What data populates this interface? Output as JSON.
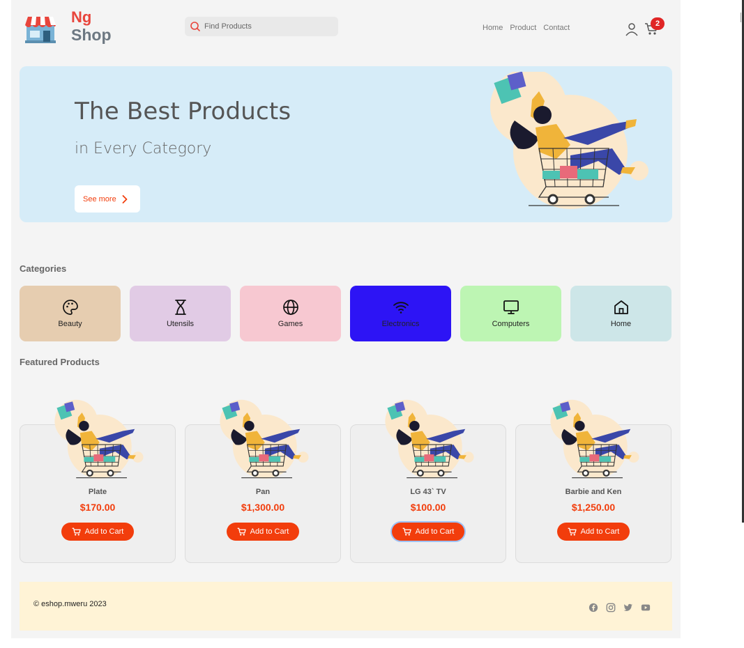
{
  "header": {
    "logo_line1": "Ng",
    "logo_line2": "Shop",
    "search_placeholder": "Find Products",
    "nav": [
      "Home",
      "Product",
      "Contact"
    ],
    "cart_count": "2"
  },
  "hero": {
    "title": "The Best Products",
    "subtitle": "in Every Category",
    "button_label": "See more"
  },
  "categories": {
    "title": "Categories",
    "items": [
      {
        "label": "Beauty",
        "icon": "palette-icon",
        "color": "#e6cdb0"
      },
      {
        "label": "Utensils",
        "icon": "hourglass-icon",
        "color": "#e1cbe5"
      },
      {
        "label": "Games",
        "icon": "globe-icon",
        "color": "#f7c8d1"
      },
      {
        "label": "Electronics",
        "icon": "wifi-icon",
        "color": "#2d14f5"
      },
      {
        "label": "Computers",
        "icon": "monitor-icon",
        "color": "#bdf5b3"
      },
      {
        "label": "Home",
        "icon": "home-icon",
        "color": "#cde6e8"
      }
    ]
  },
  "featured": {
    "title": "Featured Products",
    "add_label": "Add to Cart",
    "products": [
      {
        "name": "Plate",
        "price": "$170.00"
      },
      {
        "name": "Pan",
        "price": "$1,300.00"
      },
      {
        "name": "LG 43` TV",
        "price": "$100.00"
      },
      {
        "name": "Barbie and Ken",
        "price": "$1,250.00"
      }
    ]
  },
  "footer": {
    "copyright": "© eshop.mweru 2023",
    "social": [
      "facebook-icon",
      "instagram-icon",
      "twitter-icon",
      "youtube-icon"
    ]
  },
  "colors": {
    "accent": "#f23d0c",
    "hero_bg": "#d6ecf8",
    "footer_bg": "#fff3d6",
    "badge": "#e02525"
  }
}
